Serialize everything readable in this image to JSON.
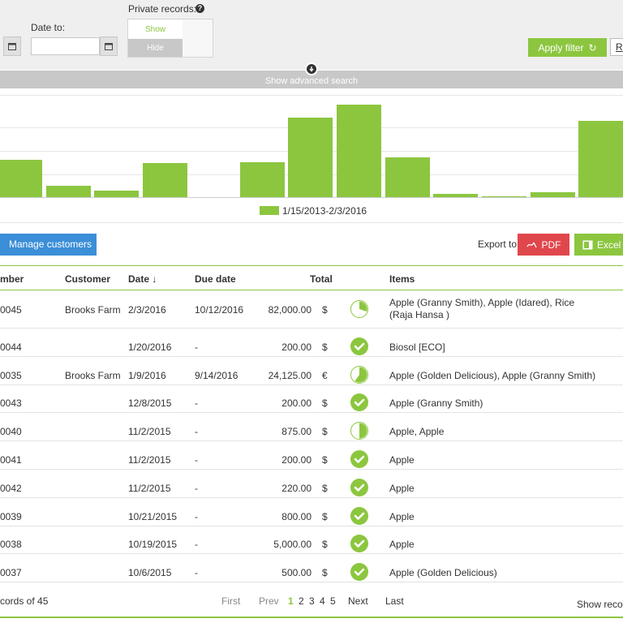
{
  "filters": {
    "date_to_label": "Date to:",
    "date_to_value": "",
    "private_records_label": "Private records:",
    "private_show": "Show",
    "private_hide": "Hide",
    "apply_filter": "Apply filter",
    "reset_partial": "R",
    "advanced_search": "Show advanced search"
  },
  "chart_data": {
    "type": "bar",
    "legend": [
      "1/15/2013-2/3/2016"
    ],
    "color": "#8cc63f",
    "values": [
      38,
      12,
      7,
      35,
      0,
      36,
      82,
      95,
      41,
      3,
      1,
      5,
      78
    ]
  },
  "actions": {
    "manage_customers": "Manage customers",
    "export_to": "Export to:",
    "pdf": "PDF",
    "excel": "Excel"
  },
  "table": {
    "headers": [
      "mber",
      "Customer",
      "Date ↓",
      "Due date",
      "Total",
      "Items"
    ],
    "rows": [
      {
        "number": "0045",
        "customer": "Brooks Farm",
        "date": "2/3/2016",
        "due": "10/12/2016",
        "total": "82,000.00",
        "cur": "$",
        "status": "partial",
        "paid_fraction": 0.3,
        "items": "Apple (Granny Smith), Apple (Idared), Rice (Raja Hansa )"
      },
      {
        "number": "0044",
        "customer": "",
        "date": "1/20/2016",
        "due": "-",
        "total": "200.00",
        "cur": "$",
        "status": "paid",
        "paid_fraction": 1,
        "items": "Biosol [ECO]"
      },
      {
        "number": "0035",
        "customer": "Brooks Farm",
        "date": "1/9/2016",
        "due": "9/14/2016",
        "total": "24,125.00",
        "cur": "€",
        "status": "partial",
        "paid_fraction": 0.6,
        "items": "Apple (Golden Delicious), Apple (Granny Smith)"
      },
      {
        "number": "0043",
        "customer": "",
        "date": "12/8/2015",
        "due": "-",
        "total": "200.00",
        "cur": "$",
        "status": "paid",
        "paid_fraction": 1,
        "items": "Apple (Granny Smith)"
      },
      {
        "number": "0040",
        "customer": "",
        "date": "11/2/2015",
        "due": "-",
        "total": "875.00",
        "cur": "$",
        "status": "partial",
        "paid_fraction": 0.5,
        "items": "Apple, Apple"
      },
      {
        "number": "0041",
        "customer": "",
        "date": "11/2/2015",
        "due": "-",
        "total": "200.00",
        "cur": "$",
        "status": "paid",
        "paid_fraction": 1,
        "items": "Apple"
      },
      {
        "number": "0042",
        "customer": "",
        "date": "11/2/2015",
        "due": "-",
        "total": "220.00",
        "cur": "$",
        "status": "paid",
        "paid_fraction": 1,
        "items": "Apple"
      },
      {
        "number": "0039",
        "customer": "",
        "date": "10/21/2015",
        "due": "-",
        "total": "800.00",
        "cur": "$",
        "status": "paid",
        "paid_fraction": 1,
        "items": "Apple"
      },
      {
        "number": "0038",
        "customer": "",
        "date": "10/19/2015",
        "due": "-",
        "total": "5,000.00",
        "cur": "$",
        "status": "paid",
        "paid_fraction": 1,
        "items": "Apple"
      },
      {
        "number": "0037",
        "customer": "",
        "date": "10/6/2015",
        "due": "-",
        "total": "500.00",
        "cur": "$",
        "status": "paid",
        "paid_fraction": 1,
        "items": "Apple (Golden Delicious)"
      }
    ]
  },
  "pagination": {
    "records": "cords of 45",
    "first": "First",
    "prev": "Prev",
    "pages": [
      "1",
      "2",
      "3",
      "4",
      "5"
    ],
    "current_page": "1",
    "next": "Next",
    "last": "Last",
    "show_records": "Show recor"
  },
  "colors": {
    "accent": "#8cc63f",
    "primary_blue": "#3b8ed8",
    "pdf_red": "#e0474c"
  }
}
